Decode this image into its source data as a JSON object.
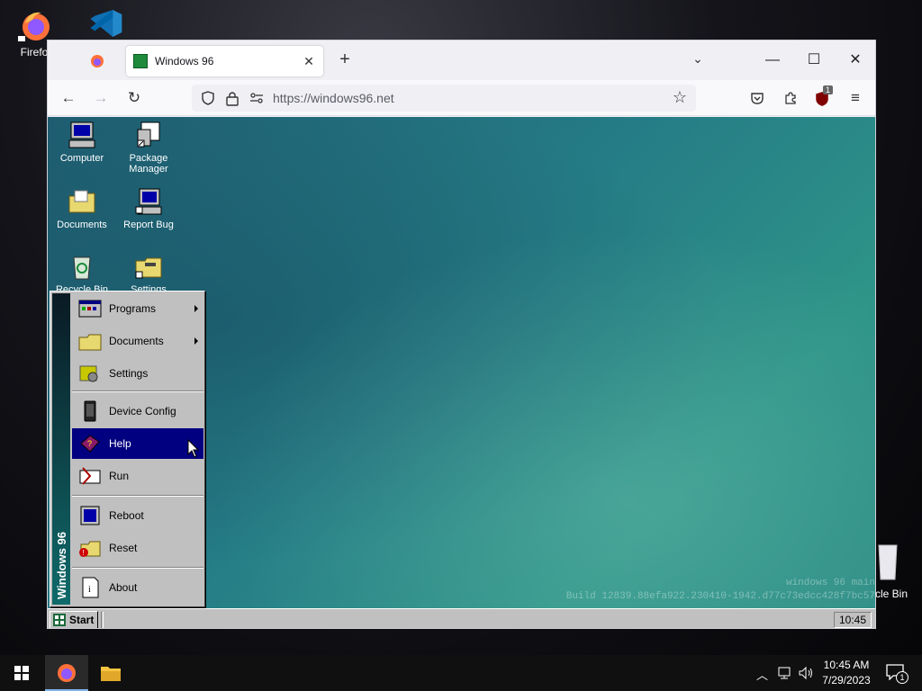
{
  "host_desktop": {
    "icons": [
      {
        "label": "Firefo",
        "name": "firefox-desktop-icon"
      },
      {
        "label": "",
        "name": "vscode-desktop-icon"
      }
    ]
  },
  "browser": {
    "tab_title": "Windows 96",
    "url_host": "https://windows96.net",
    "extension_badge": "1"
  },
  "win96": {
    "desktop_icons": [
      {
        "label": "Computer"
      },
      {
        "label": "Package Manager"
      },
      {
        "label": "Documents"
      },
      {
        "label": "Report Bug"
      },
      {
        "label": "Recycle Bin"
      },
      {
        "label": "Settings"
      }
    ],
    "start_menu": {
      "banner": "Windows 96",
      "items": [
        {
          "label": "Programs"
        },
        {
          "label": "Documents"
        },
        {
          "label": "Settings"
        },
        {
          "label": "Device Config"
        },
        {
          "label": "Help"
        },
        {
          "label": "Run"
        },
        {
          "label": "Reboot"
        },
        {
          "label": "Reset"
        },
        {
          "label": "About"
        }
      ]
    },
    "build_line1": "windows 96 main",
    "build_line2": "Build 12839.88efa922.230410-1942.d77c73edcc428f7bc57",
    "recycle_right": "cle Bin",
    "taskbar": {
      "start_label": "Start",
      "clock": "10:45"
    }
  },
  "host_taskbar": {
    "time": "10:45 AM",
    "date": "7/29/2023",
    "notifications": "1"
  },
  "colors": {
    "highlight": "#000080",
    "win96_gray": "#c0c0c0",
    "desktop_teal": "#257c86"
  }
}
